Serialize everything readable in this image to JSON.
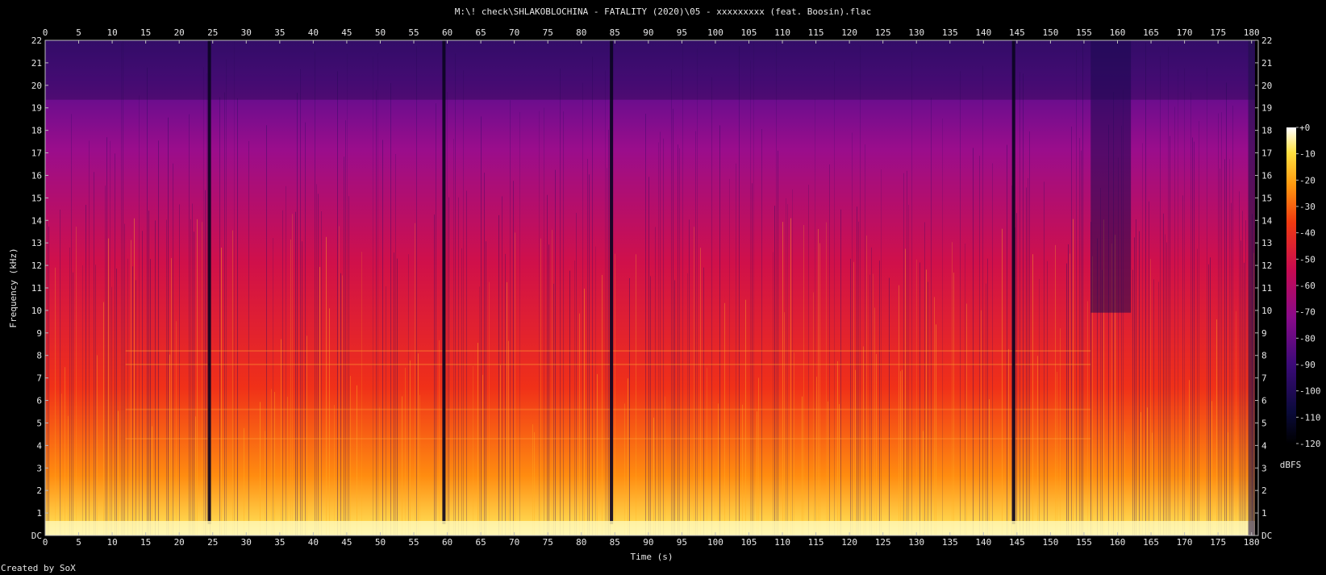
{
  "title": "M:\\! check\\SHLAKOBLOCHINA - FATALITY (2020)\\05 - xxxxxxxxx (feat. Boosin).flac",
  "credit": "Created by SoX",
  "chart_data": {
    "type": "heatmap",
    "title": "M:\\! check\\SHLAKOBLOCHINA - FATALITY (2020)\\05 - xxxxxxxxx (feat. Boosin).flac",
    "xlabel": "Time (s)",
    "ylabel": "Frequency (kHz)",
    "xlim": [
      0,
      181
    ],
    "ylim": [
      0,
      22
    ],
    "x_ticks": [
      0,
      5,
      10,
      15,
      20,
      25,
      30,
      35,
      40,
      45,
      50,
      55,
      60,
      65,
      70,
      75,
      80,
      85,
      90,
      95,
      100,
      105,
      110,
      115,
      120,
      125,
      130,
      135,
      140,
      145,
      150,
      155,
      160,
      165,
      170,
      175,
      180
    ],
    "y_ticks": [
      "DC",
      "1",
      "2",
      "3",
      "4",
      "5",
      "6",
      "7",
      "8",
      "9",
      "10",
      "11",
      "12",
      "13",
      "14",
      "15",
      "16",
      "17",
      "18",
      "19",
      "20",
      "21",
      "22"
    ],
    "colorbar": {
      "label": "dBFS",
      "range": [
        -120,
        0
      ],
      "ticks": [
        "+0",
        "-10",
        "-20",
        "-30",
        "-40",
        "-50",
        "-60",
        "-70",
        "-80",
        "-90",
        "-100",
        "-110",
        "-120"
      ]
    },
    "notable_gaps_s": [
      24.5,
      59.5,
      84.5,
      144.5
    ],
    "quiet_region_s": [
      156,
      162
    ]
  }
}
